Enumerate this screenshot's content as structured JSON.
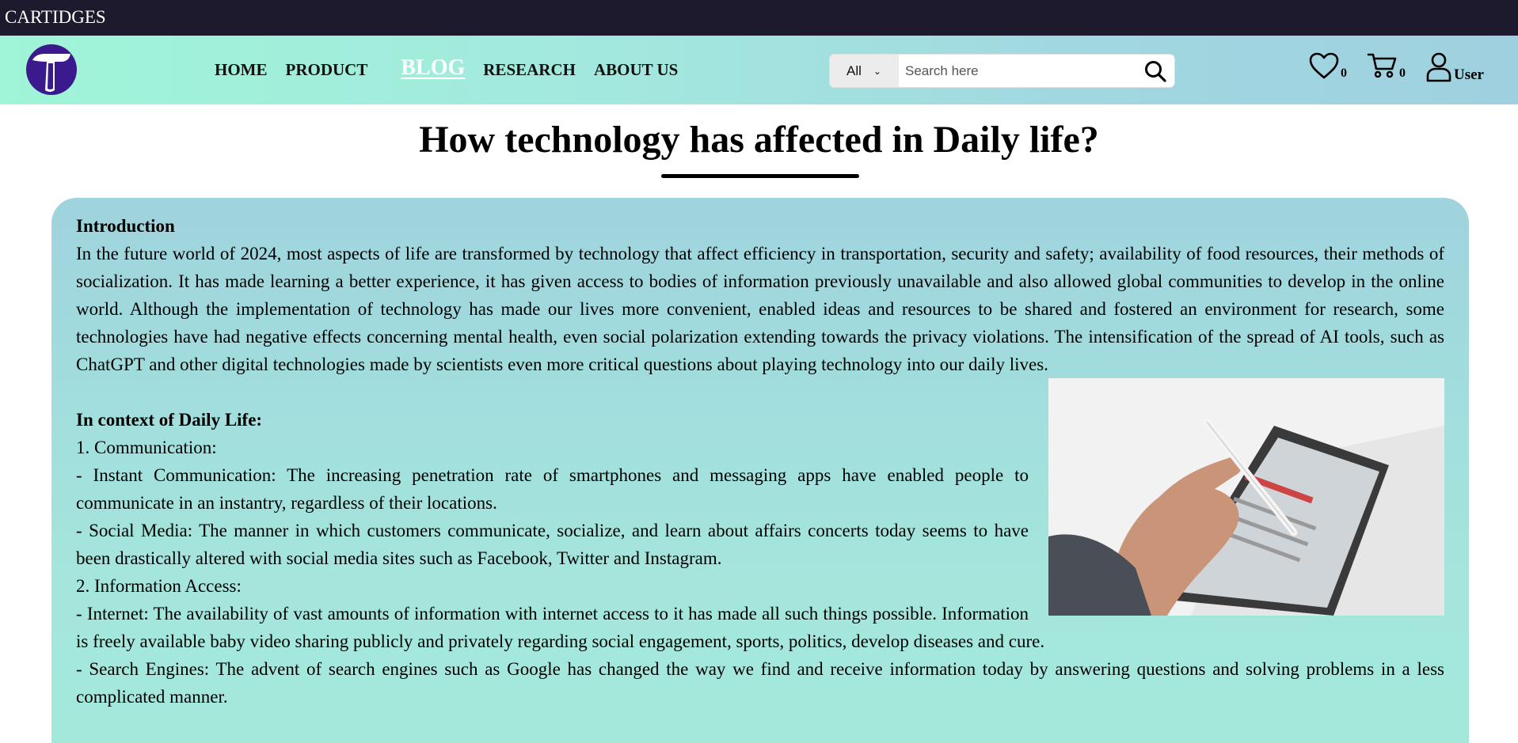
{
  "topbar": {
    "brand": "CARTIDGES"
  },
  "nav": {
    "items": [
      {
        "label": "HOME"
      },
      {
        "label": "PRODUCT"
      },
      {
        "label": "BLOG",
        "active": true
      },
      {
        "label": "RESEARCH"
      },
      {
        "label": "ABOUT US"
      }
    ]
  },
  "search": {
    "category": "All",
    "placeholder": "Search here"
  },
  "header_icons": {
    "wishlist_count": "0",
    "cart_count": "0",
    "user_label": "User"
  },
  "article": {
    "title": "How technology has affected in Daily life?",
    "intro_heading": "Introduction",
    "intro_text": "In the future world of 2024, most aspects of life are transformed by technology that affect efficiency in transportation, security and safety; availability of food resources, their methods of socialization. It has made learning a better experience, it has given access to bodies of information previously unavailable and also allowed global communities to develop in the online world. Although the implementation of technology has made our lives more convenient, enabled ideas and resources to be shared and fostered an environment for research, some technologies have had negative effects concerning mental health, even social polarization extending towards the privacy violations. The intensification of the spread of AI tools, such as ChatGPT and other digital technologies made by scientists even more critical questions about playing technology into our daily lives.",
    "daily_heading": "In context of Daily Life:",
    "daily_lines": [
      "1. Communication:",
      "- Instant Communication: The increasing penetration rate of smartphones and messaging apps have enabled people to communicate in an instantry, regardless of their locations.",
      "- Social Media: The manner in which customers communicate, socialize, and learn about affairs concerts today seems to have been drastically altered with social media sites such as Facebook, Twitter and Instagram.",
      "2. Information Access:",
      "- Internet: The availability of vast amounts of information with internet access to it has made all such things possible. Information is freely available baby video sharing publicly and privately regarding social engagement, sports, politics, develop diseases and cure.",
      "- Search Engines: The advent of search engines such as Google has changed the way we find and receive information today by answering questions and solving problems in a less complicated manner."
    ]
  }
}
